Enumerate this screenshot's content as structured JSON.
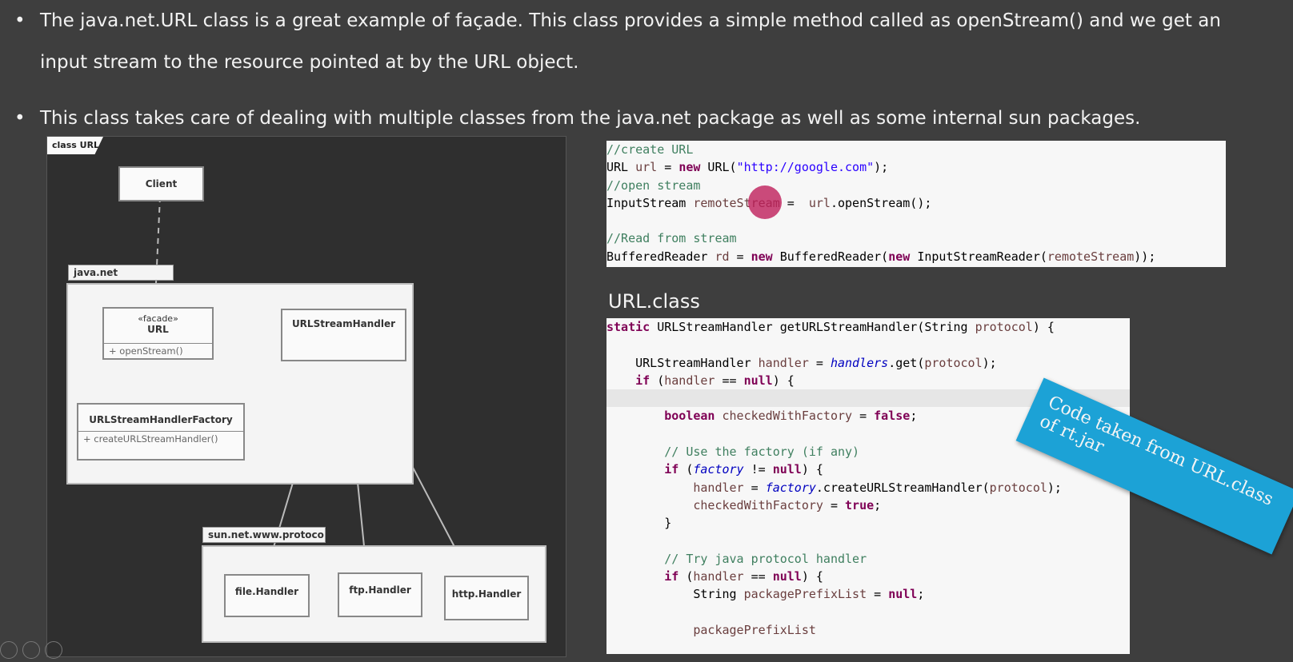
{
  "bullets": [
    {
      "symbol": "•",
      "text": "The java.net.URL class is a great example of façade. This class provides a simple method called as openStream() and we get an input stream to the resource pointed at by the URL object."
    },
    {
      "symbol": "•",
      "text": "This class takes care of dealing with multiple classes from the java.net package as well as some internal sun packages."
    }
  ],
  "diagram": {
    "tab": "class URL",
    "packages": {
      "java_net": "java.net",
      "sun_net": "sun.net.www.protoco"
    },
    "classes": {
      "client": "Client",
      "url_stereotype": "«facade»",
      "url": "URL",
      "url_op": "+   openStream()",
      "handler": "URLStreamHandler",
      "factory": "URLStreamHandlerFactory",
      "factory_op": "+   createURLStreamHandler()",
      "file_handler": "file.Handler",
      "ftp_handler": "ftp.Handler",
      "http_handler": "http.Handler"
    }
  },
  "url_class_label": "URL.class",
  "callout": "Code taken from URL.class of rt.jar",
  "colors": {
    "background": "#3e3e3e",
    "callout": "#1ca2d6",
    "cursor": "#be1e5a"
  }
}
